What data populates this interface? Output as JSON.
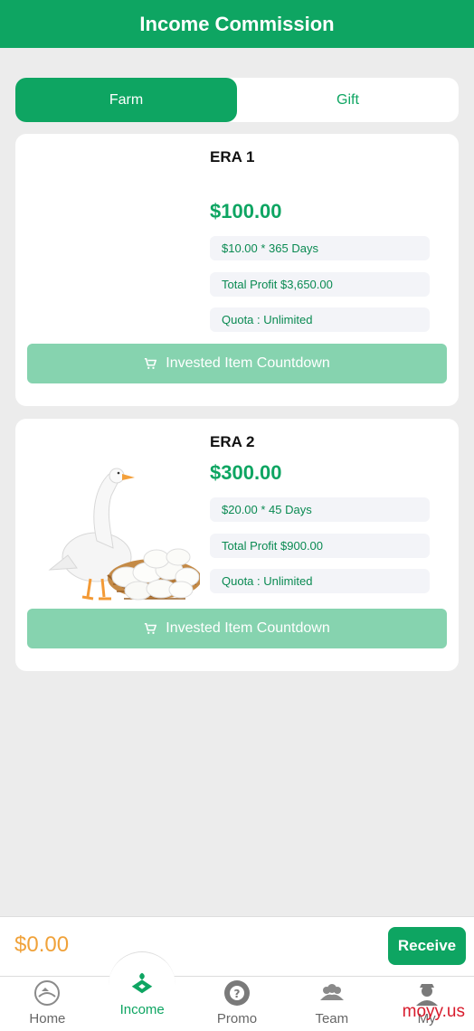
{
  "header": {
    "title": "Income Commission"
  },
  "tabs": [
    {
      "label": "Farm",
      "active": true
    },
    {
      "label": "Gift",
      "active": false
    }
  ],
  "products": [
    {
      "name": "ERA 1",
      "price": "$100.00",
      "daily": "$10.00 * 365 Days",
      "total": "Total Profit $3,650.00",
      "quota": "Quota : Unlimited",
      "button": "Invested Item Countdown",
      "image": "blank"
    },
    {
      "name": "ERA 2",
      "price": "$300.00",
      "daily": "$20.00 * 45 Days",
      "total": "Total Profit $900.00",
      "quota": "Quota : Unlimited",
      "button": "Invested Item Countdown",
      "image": "goose-with-eggs-basket"
    }
  ],
  "balance": {
    "amount": "$0.00",
    "receive_label": "Receive"
  },
  "nav": [
    {
      "label": "Home",
      "icon": "home-icon"
    },
    {
      "label": "Income",
      "icon": "income-icon",
      "active": true
    },
    {
      "label": "Promo",
      "icon": "promo-icon"
    },
    {
      "label": "Team",
      "icon": "team-icon"
    },
    {
      "label": "My",
      "icon": "user-icon"
    }
  ],
  "watermark": "moyy.us",
  "colors": {
    "primary": "#0ea562",
    "button_disabled": "#86d3af",
    "balance": "#f0a23a"
  }
}
